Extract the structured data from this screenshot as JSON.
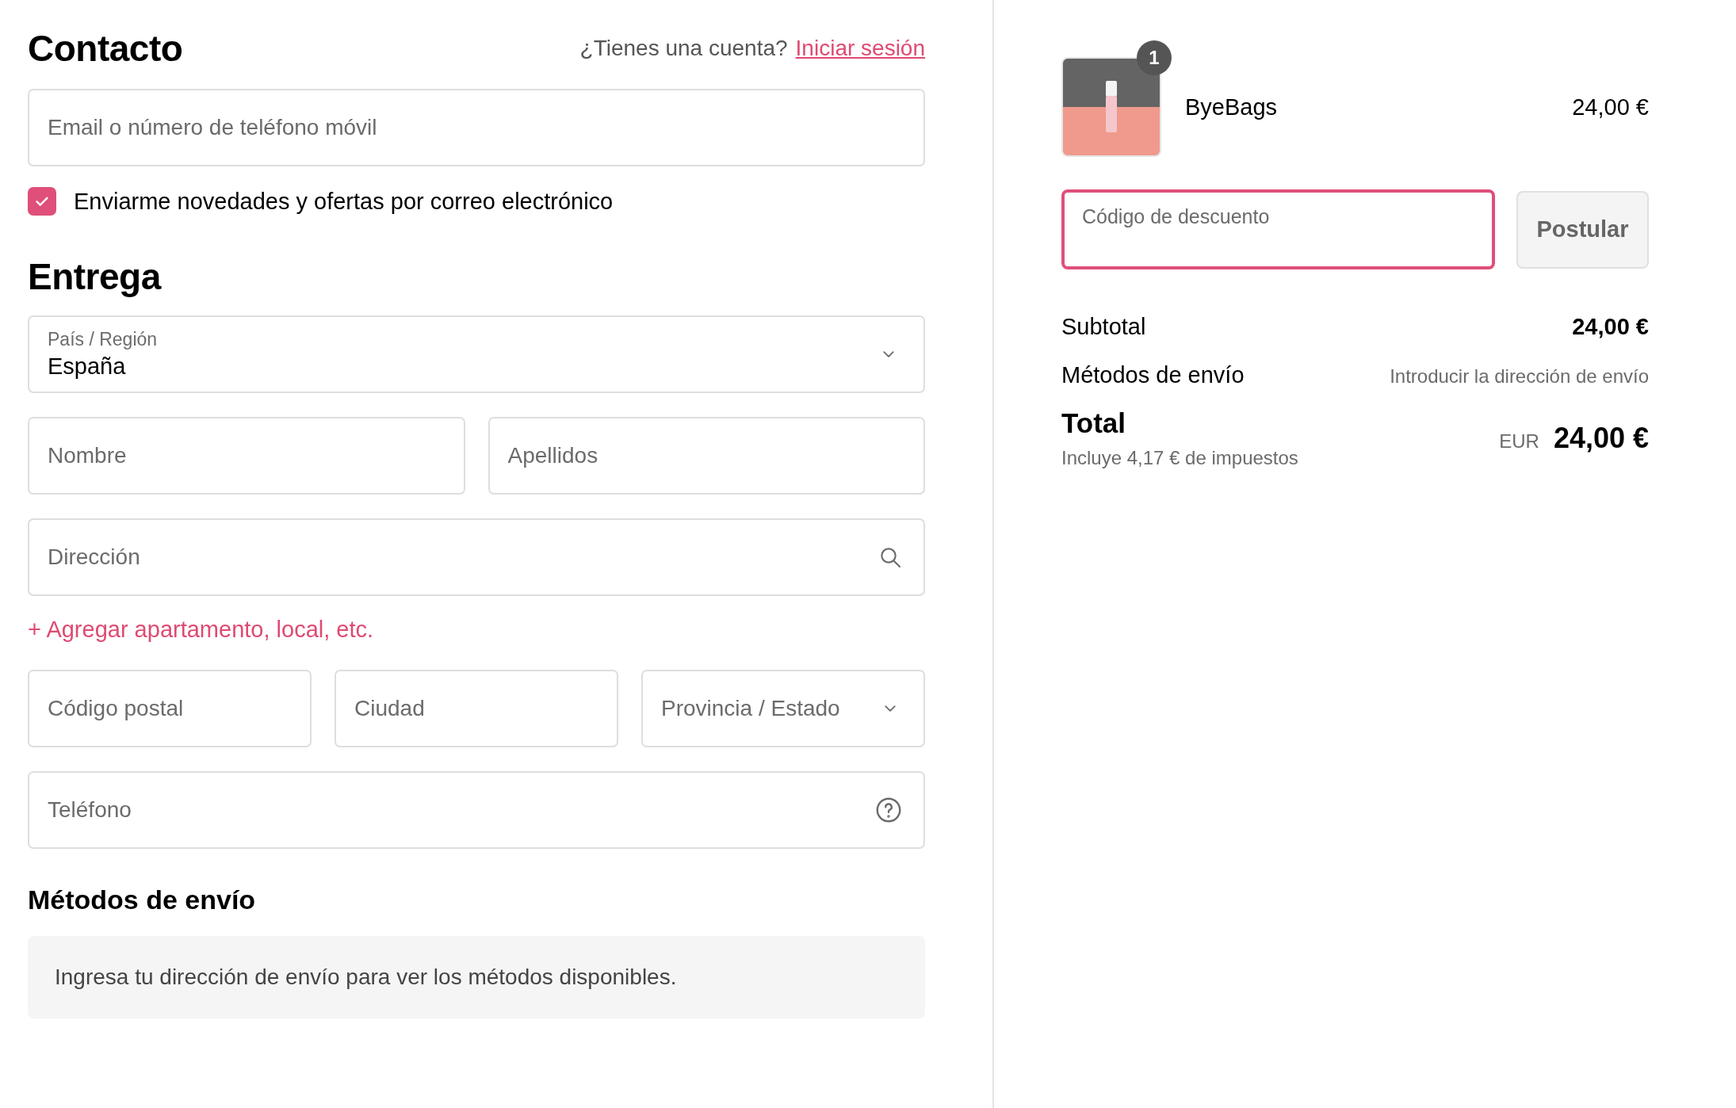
{
  "contact": {
    "title": "Contacto",
    "account_prompt": "¿Tienes una cuenta?",
    "login_link": "Iniciar sesión",
    "email": {
      "placeholder": "Email o número de teléfono móvil"
    },
    "newsletter": {
      "label": "Enviarme novedades y ofertas por correo electrónico",
      "checked": true
    }
  },
  "delivery": {
    "title": "Entrega",
    "fields": [
      {
        "kind": "select",
        "label": "País / Región",
        "value": "España"
      },
      {
        "kind": "row",
        "fields": [
          {
            "kind": "text",
            "placeholder": "Nombre"
          },
          {
            "kind": "text",
            "placeholder": "Apellidos"
          }
        ]
      },
      {
        "kind": "search",
        "placeholder": "Dirección"
      },
      {
        "kind": "link",
        "label": "+ Agregar apartamento, local, etc."
      },
      {
        "kind": "row",
        "fields": [
          {
            "kind": "text",
            "placeholder": "Código postal"
          },
          {
            "kind": "text",
            "placeholder": "Ciudad"
          },
          {
            "kind": "select",
            "placeholder": "Provincia / Estado"
          }
        ]
      },
      {
        "kind": "help",
        "placeholder": "Teléfono"
      }
    ]
  },
  "shipping": {
    "title": "Métodos de envío",
    "notice": "Ingresa tu dirección de envío para ver los métodos disponibles."
  },
  "summary": {
    "item": {
      "quantity": "1",
      "name": "ByeBags",
      "price": "24,00 €"
    },
    "discount": {
      "placeholder": "Código de descuento",
      "focused": true,
      "button": "Postular"
    },
    "lines": [
      {
        "label": "Subtotal",
        "value": "24,00 €",
        "kind": "amount"
      },
      {
        "label": "Métodos de envío",
        "value": "Introducir la dirección de envío",
        "kind": "note"
      }
    ],
    "total": {
      "label": "Total",
      "taxes": "Incluye 4,17 € de impuestos",
      "currency": "EUR",
      "value": "24,00 €"
    }
  }
}
